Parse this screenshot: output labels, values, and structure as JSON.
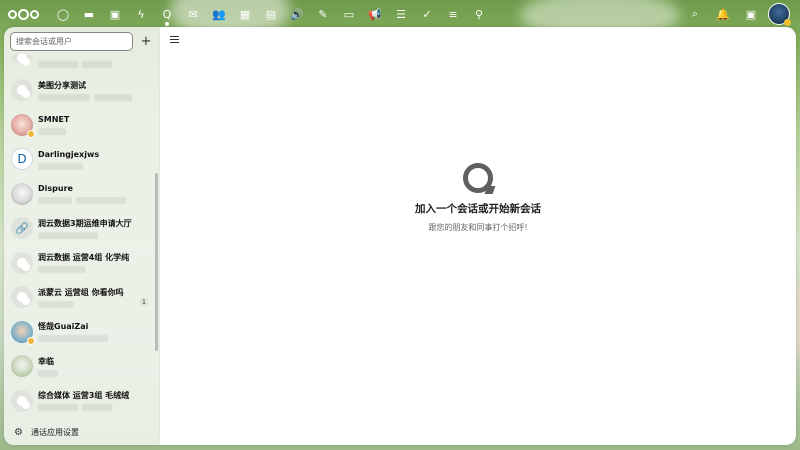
{
  "colors": {
    "sidebar_bg": "#eef2eb",
    "accent": "#0e61a8",
    "status_away": "#f0b63a"
  },
  "header": {
    "apps": [
      {
        "name": "dashboard",
        "icon": "circle-icon",
        "glyph": "◯"
      },
      {
        "name": "files",
        "icon": "folder-icon",
        "glyph": "▬"
      },
      {
        "name": "photos",
        "icon": "image-icon",
        "glyph": "▣"
      },
      {
        "name": "activity",
        "icon": "bolt-icon",
        "glyph": "ϟ"
      },
      {
        "name": "talk",
        "icon": "talk-icon",
        "glyph": "Q",
        "active": true
      },
      {
        "name": "mail",
        "icon": "mail-icon",
        "glyph": "✉"
      },
      {
        "name": "contacts",
        "icon": "contacts-icon",
        "glyph": "👥"
      },
      {
        "name": "calendar",
        "icon": "calendar-icon",
        "glyph": "▦"
      },
      {
        "name": "deck",
        "icon": "deck-icon",
        "glyph": "▤"
      },
      {
        "name": "audio",
        "icon": "speaker-icon",
        "glyph": "🔊"
      },
      {
        "name": "notes",
        "icon": "pencil-icon",
        "glyph": "✎"
      },
      {
        "name": "bookmarks",
        "icon": "briefcase-icon",
        "glyph": "▭"
      },
      {
        "name": "announcements",
        "icon": "megaphone-icon",
        "glyph": "📢"
      },
      {
        "name": "tasks",
        "icon": "list-icon",
        "glyph": "☰"
      },
      {
        "name": "checklist",
        "icon": "check-icon",
        "glyph": "✓"
      },
      {
        "name": "forms",
        "icon": "text-lines-icon",
        "glyph": "≡"
      },
      {
        "name": "maps",
        "icon": "location-pin-icon",
        "glyph": "⚲"
      }
    ],
    "right": [
      {
        "name": "search",
        "icon": "search-icon",
        "glyph": "⌕"
      },
      {
        "name": "notifications",
        "icon": "bell-icon",
        "glyph": "🔔"
      },
      {
        "name": "contacts-menu",
        "icon": "contacts-menu-icon",
        "glyph": "▣"
      }
    ]
  },
  "sidebar": {
    "search_placeholder": "搜索会话或用户",
    "new_conversation_label": "+",
    "conversations": [
      {
        "name": "",
        "avatar": "group",
        "unread": ""
      },
      {
        "name": "美图分享测试",
        "avatar": "group",
        "unread": ""
      },
      {
        "name": "SMNET",
        "avatar": "pic1",
        "status": true,
        "unread": ""
      },
      {
        "name": "Darlingjexjws",
        "avatar": "letter",
        "letter": "D",
        "unread": ""
      },
      {
        "name": "Dispure",
        "avatar": "pic2",
        "unread": ""
      },
      {
        "name": "润云数据3期运维申请大厅",
        "avatar": "link",
        "unread": ""
      },
      {
        "name": "润云数据 运营4组 化学纯",
        "avatar": "group",
        "unread": ""
      },
      {
        "name": "派蒙云 运营组 你看你吗",
        "avatar": "group",
        "unread": "1"
      },
      {
        "name": "怪哉GuaiZai",
        "avatar": "pic3",
        "status": true,
        "unread": ""
      },
      {
        "name": "幸临",
        "avatar": "pic4",
        "unread": ""
      },
      {
        "name": "综合媒体 运营3组 毛绒绒",
        "avatar": "group",
        "unread": ""
      }
    ],
    "settings_label": "通话应用设置"
  },
  "main": {
    "empty_title": "加入一个会话或开始新会话",
    "empty_subtitle": "跟您的朋友和同事打个招呼!"
  }
}
